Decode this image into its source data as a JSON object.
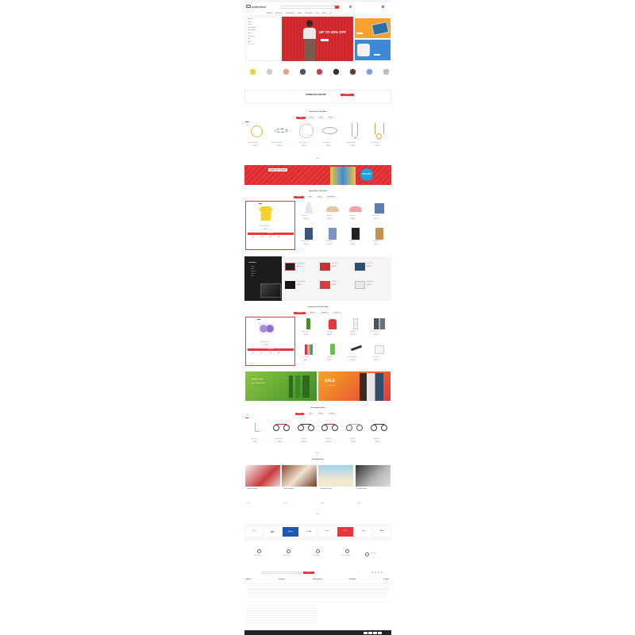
{
  "topbar": {
    "text": "Welcome to Unlimited",
    "right": "My Account"
  },
  "header": {
    "logo": "unlimited",
    "search_placeholder": "Search anything...",
    "contact_label": "Need Help? Call Us",
    "cart_label": "Cart"
  },
  "nav": {
    "items": [
      "FEATURES",
      "SHOP LAYOUT",
      "SINGLE PRODUCT",
      "PAGES",
      "TOPS & SKIRTS",
      "BLOG",
      "CONTACT",
      "BUY"
    ]
  },
  "categories": [
    "Electronics",
    "Fashion",
    "Jewelry",
    "Home & Kitchen",
    "Beauty & Health",
    "Sports",
    "Toys & Games",
    "Bags",
    "Shoes",
    "All Categories"
  ],
  "hero": {
    "headline": "UP TO 40% OFF",
    "sub": "Winter Collection"
  },
  "side_banners": [
    {
      "title": "Tablet Sale"
    },
    {
      "title": "Audio Deals"
    }
  ],
  "app_bar": {
    "text": "Get the app on your phone",
    "title": "DOWNLOAD OUR APP",
    "button": "Download"
  },
  "best_sellers": {
    "title": "Best Sellers In This Week",
    "tabs": [
      "Jewelry",
      "Rings",
      "Bags",
      "Shoes"
    ],
    "items": [
      {
        "name": "Gold Hoop Bracelet",
        "price": "$55.00",
        "old": "$70.00"
      },
      {
        "name": "Silver Chain Bracelet",
        "price": "$42.00",
        "old": ""
      },
      {
        "name": "Pearl Necklace",
        "price": "$89.00",
        "old": ""
      },
      {
        "name": "Charm Bracelet",
        "price": "$36.00",
        "old": ""
      },
      {
        "name": "Pendant Necklace",
        "price": "$64.00",
        "old": ""
      },
      {
        "name": "Heart Necklace",
        "price": "$72.00",
        "old": ""
      }
    ]
  },
  "end_year": {
    "title": "END OF YEAR",
    "discount": "55% OFF"
  },
  "special_offer": {
    "title": "Special Offer In This Week",
    "tabs": [
      "Fashion",
      "Kids",
      "Shoes",
      "Accessories"
    ],
    "featured": {
      "name": "Kids Yellow T-Shirt",
      "price": "$24.00",
      "button": "Add to Cart"
    },
    "countdown": [
      "30",
      "12",
      "45",
      "08"
    ],
    "items": [
      {
        "name": "Girls Dress",
        "price": "$32.00"
      },
      {
        "name": "Sneakers",
        "price": "$45.00"
      },
      {
        "name": "Pink Shoes",
        "price": "$38.00"
      },
      {
        "name": "Denim Shorts",
        "price": "$29.00"
      },
      {
        "name": "Denim Overalls",
        "price": "$41.00"
      },
      {
        "name": "Kids Jeans",
        "price": "$27.00"
      },
      {
        "name": "Black Dress",
        "price": "$35.00"
      },
      {
        "name": "Printed Shirt",
        "price": "$22.00"
      }
    ]
  },
  "electronics": {
    "title": "Electronics",
    "menu": [
      "Laptops",
      "Tablets",
      "Televisions",
      "Cameras",
      "Audio"
    ],
    "items": [
      {
        "name": "Smart Monitor",
        "price": "$299.00"
      },
      {
        "name": "Smart TV 43\"",
        "price": "$459.00"
      },
      {
        "name": "LED TV 55\"",
        "price": "$629.00"
      },
      {
        "name": "Gaming Monitor",
        "price": "$349.00"
      },
      {
        "name": "Tablet Pro",
        "price": "$389.00"
      },
      {
        "name": "Mini Projector",
        "price": "$189.00"
      }
    ]
  },
  "cosmetics": {
    "title": "Cosmetics Items In This Week",
    "tabs": [
      "Skin Care",
      "Makeup",
      "Fragrance",
      "Hair Care"
    ],
    "featured": {
      "name": "Purple Soap Set",
      "price": "$18.00",
      "button": "Add to Cart"
    },
    "countdown": [
      "30",
      "12",
      "45",
      "08"
    ],
    "items": [
      {
        "name": "Vitamin Serum",
        "price": "$26.00"
      },
      {
        "name": "Hair Dryer",
        "price": "$49.00"
      },
      {
        "name": "Body Lotion",
        "price": "$15.00"
      },
      {
        "name": "Men Grooming Kit",
        "price": "$33.00"
      },
      {
        "name": "Nail Polish",
        "price": "$9.00"
      },
      {
        "name": "Aloe Gel",
        "price": "$12.00"
      },
      {
        "name": "Hair Straightener",
        "price": "$39.00"
      },
      {
        "name": "Cream Jar",
        "price": "$21.00"
      }
    ]
  },
  "promo": [
    {
      "title": "Beauty & Health",
      "sub": "UP TO 60% OFF"
    },
    {
      "title": "SALE",
      "sub": "UP TO 70% OFF"
    }
  ],
  "recommended": {
    "title": "Recommended Items",
    "tabs": [
      "Bikes",
      "Kids",
      "Sports",
      "Outdoor"
    ],
    "items": [
      {
        "name": "Kids Scooter",
        "price": "$89.00"
      },
      {
        "name": "Mountain Bike",
        "price": "$349.00"
      },
      {
        "name": "City Bike",
        "price": "$289.00"
      },
      {
        "name": "Road Bike",
        "price": "$459.00"
      },
      {
        "name": "Kids Bike",
        "price": "$159.00"
      },
      {
        "name": "Hybrid Bike",
        "price": "$329.00"
      }
    ]
  },
  "blog": {
    "title": "Latest Blog Posts",
    "posts": [
      {
        "title": "Christmas Gift Ideas",
        "meta": "Dec 12"
      },
      {
        "title": "Kids Party Fashion",
        "meta": "Dec 10"
      },
      {
        "title": "Summer Beach Looks",
        "meta": "Dec 08"
      },
      {
        "title": "Street Style Guide",
        "meta": "Dec 05"
      }
    ]
  },
  "brands": [
    "Brand",
    "ck",
    "Chicco",
    "OCEAN",
    "Lacoste",
    "Brand",
    "Lightly",
    "Gucci"
  ],
  "services": [
    {
      "title": "Free Shipping"
    },
    {
      "title": "Money Back"
    },
    {
      "title": "Online Support"
    },
    {
      "title": "Secure Payment"
    },
    {
      "title": "Gift Cards"
    }
  ],
  "newsletter": {
    "title": "NEWSLETTER",
    "button": "Subscribe",
    "social_title": "Stay Connected"
  },
  "footer": {
    "columns": [
      "About Us",
      "Information",
      "Customer Service",
      "My Account",
      "Our Policy"
    ],
    "copyright": "© Copyright Unlimited. All Rights Reserved."
  },
  "colors": {
    "accent": "#e8363b"
  }
}
